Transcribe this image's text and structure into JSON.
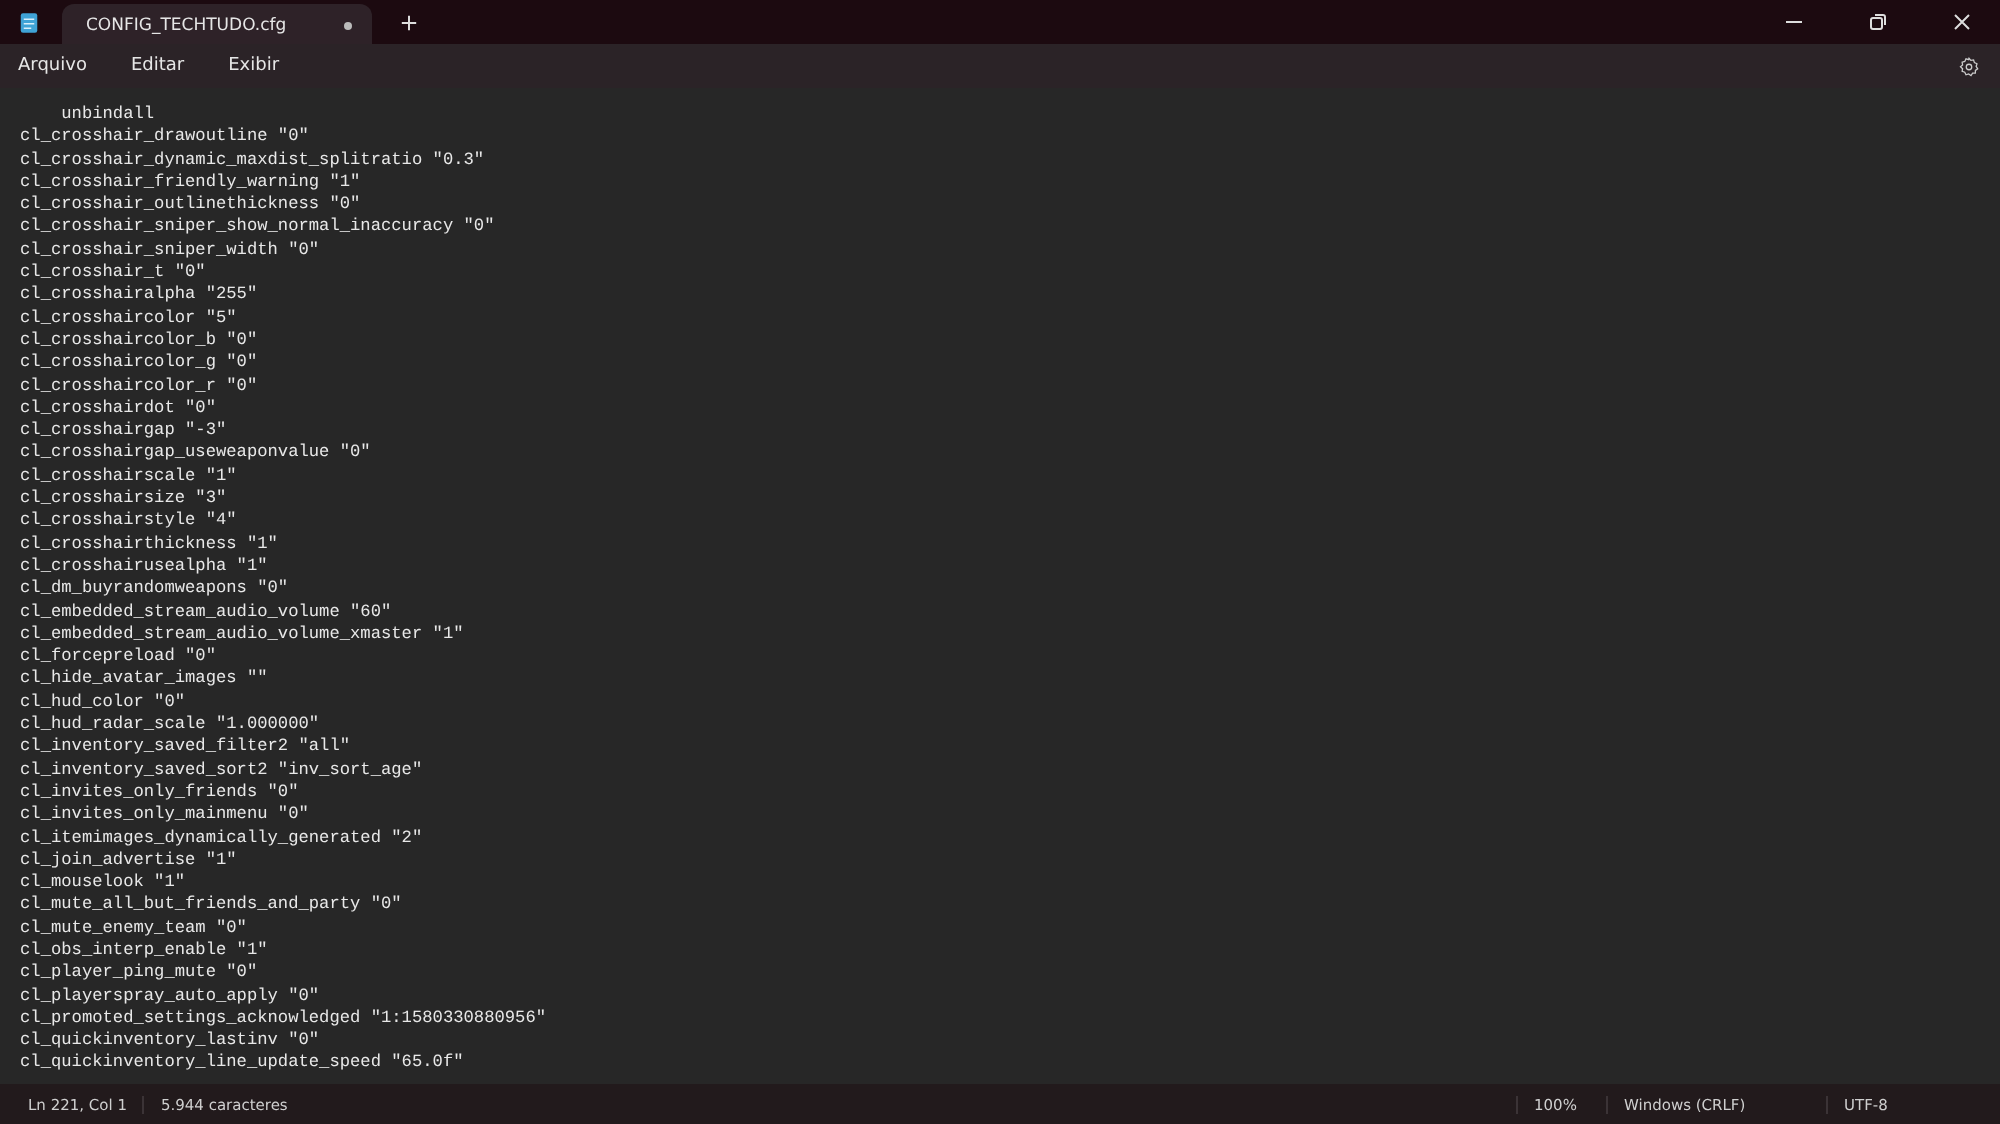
{
  "tabs": [
    {
      "title": "CONFIG_TECHTUDO.cfg",
      "selected": true,
      "modified": true
    }
  ],
  "menu": [
    "Arquivo",
    "Editar",
    "Exibir"
  ],
  "lines": [
    "    unbindall",
    "cl_crosshair_drawoutline \"0\"",
    "cl_crosshair_dynamic_maxdist_splitratio \"0.3\"",
    "cl_crosshair_friendly_warning \"1\"",
    "cl_crosshair_outlinethickness \"0\"",
    "cl_crosshair_sniper_show_normal_inaccuracy \"0\"",
    "cl_crosshair_sniper_width \"0\"",
    "cl_crosshair_t \"0\"",
    "cl_crosshairalpha \"255\"",
    "cl_crosshaircolor \"5\"",
    "cl_crosshaircolor_b \"0\"",
    "cl_crosshaircolor_g \"0\"",
    "cl_crosshaircolor_r \"0\"",
    "cl_crosshairdot \"0\"",
    "cl_crosshairgap \"-3\"",
    "cl_crosshairgap_useweaponvalue \"0\"",
    "cl_crosshairscale \"1\"",
    "cl_crosshairsize \"3\"",
    "cl_crosshairstyle \"4\"",
    "cl_crosshairthickness \"1\"",
    "cl_crosshairusealpha \"1\"",
    "cl_dm_buyrandomweapons \"0\"",
    "cl_embedded_stream_audio_volume \"60\"",
    "cl_embedded_stream_audio_volume_xmaster \"1\"",
    "cl_forcepreload \"0\"",
    "cl_hide_avatar_images \"\"",
    "cl_hud_color \"0\"",
    "cl_hud_radar_scale \"1.000000\"",
    "cl_inventory_saved_filter2 \"all\"",
    "cl_inventory_saved_sort2 \"inv_sort_age\"",
    "cl_invites_only_friends \"0\"",
    "cl_invites_only_mainmenu \"0\"",
    "cl_itemimages_dynamically_generated \"2\"",
    "cl_join_advertise \"1\"",
    "cl_mouselook \"1\"",
    "cl_mute_all_but_friends_and_party \"0\"",
    "cl_mute_enemy_team \"0\"",
    "cl_obs_interp_enable \"1\"",
    "cl_player_ping_mute \"0\"",
    "cl_playerspray_auto_apply \"0\"",
    "cl_promoted_settings_acknowledged \"1:1580330880956\"",
    "cl_quickinventory_lastinv \"0\"",
    "cl_quickinventory_line_update_speed \"65.0f\""
  ],
  "status_bar": {
    "position": "Ln 221, Col 1",
    "characters": "5.944 caracteres",
    "zoom": "100%",
    "line_ending": "Windows (CRLF)",
    "encoding": "UTF-8"
  }
}
